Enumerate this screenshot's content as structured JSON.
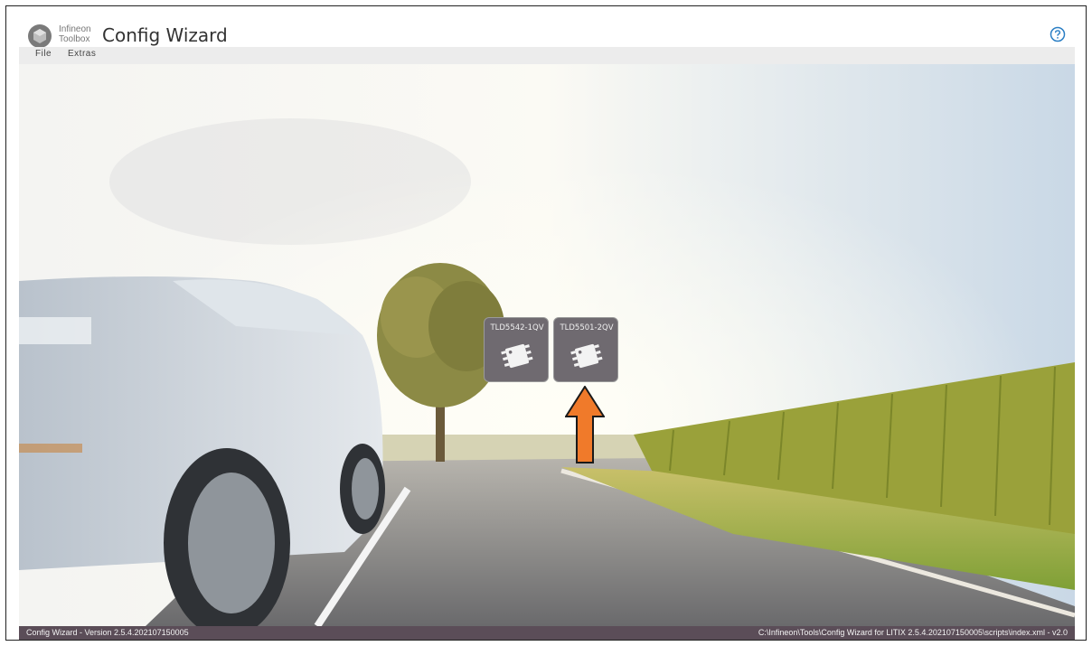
{
  "header": {
    "brand_line1": "Infineon",
    "brand_line2": "Toolbox",
    "title": "Config Wizard",
    "help_icon": "help-circle-icon"
  },
  "menu": {
    "items": [
      {
        "label": "File"
      },
      {
        "label": "Extras"
      }
    ]
  },
  "devices": [
    {
      "label": "TLD5542-1QV",
      "icon": "chip-icon"
    },
    {
      "label": "TLD5501-2QV",
      "icon": "chip-icon"
    }
  ],
  "annotation": {
    "arrow_icon": "arrow-up-icon",
    "arrow_color": "#f07a2a"
  },
  "status": {
    "left": "Config Wizard - Version 2.5.4.202107150005",
    "right": "C:\\Infineon\\Tools\\Config Wizard for LITIX 2.5.4.202107150005\\scripts\\index.xml - v2.0"
  },
  "colors": {
    "statusbar": "#5b4d58",
    "tile": "#6f6a70",
    "menubar": "#ececec"
  }
}
